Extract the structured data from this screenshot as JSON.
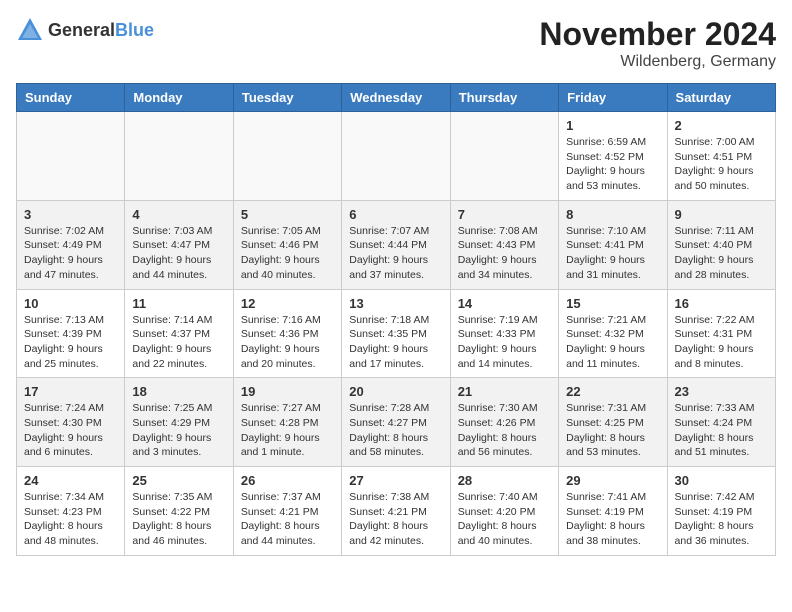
{
  "header": {
    "logo_general": "General",
    "logo_blue": "Blue",
    "title": "November 2024",
    "subtitle": "Wildenberg, Germany"
  },
  "weekdays": [
    "Sunday",
    "Monday",
    "Tuesday",
    "Wednesday",
    "Thursday",
    "Friday",
    "Saturday"
  ],
  "weeks": [
    [
      {
        "day": "",
        "info": ""
      },
      {
        "day": "",
        "info": ""
      },
      {
        "day": "",
        "info": ""
      },
      {
        "day": "",
        "info": ""
      },
      {
        "day": "",
        "info": ""
      },
      {
        "day": "1",
        "info": "Sunrise: 6:59 AM\nSunset: 4:52 PM\nDaylight: 9 hours and 53 minutes."
      },
      {
        "day": "2",
        "info": "Sunrise: 7:00 AM\nSunset: 4:51 PM\nDaylight: 9 hours and 50 minutes."
      }
    ],
    [
      {
        "day": "3",
        "info": "Sunrise: 7:02 AM\nSunset: 4:49 PM\nDaylight: 9 hours and 47 minutes."
      },
      {
        "day": "4",
        "info": "Sunrise: 7:03 AM\nSunset: 4:47 PM\nDaylight: 9 hours and 44 minutes."
      },
      {
        "day": "5",
        "info": "Sunrise: 7:05 AM\nSunset: 4:46 PM\nDaylight: 9 hours and 40 minutes."
      },
      {
        "day": "6",
        "info": "Sunrise: 7:07 AM\nSunset: 4:44 PM\nDaylight: 9 hours and 37 minutes."
      },
      {
        "day": "7",
        "info": "Sunrise: 7:08 AM\nSunset: 4:43 PM\nDaylight: 9 hours and 34 minutes."
      },
      {
        "day": "8",
        "info": "Sunrise: 7:10 AM\nSunset: 4:41 PM\nDaylight: 9 hours and 31 minutes."
      },
      {
        "day": "9",
        "info": "Sunrise: 7:11 AM\nSunset: 4:40 PM\nDaylight: 9 hours and 28 minutes."
      }
    ],
    [
      {
        "day": "10",
        "info": "Sunrise: 7:13 AM\nSunset: 4:39 PM\nDaylight: 9 hours and 25 minutes."
      },
      {
        "day": "11",
        "info": "Sunrise: 7:14 AM\nSunset: 4:37 PM\nDaylight: 9 hours and 22 minutes."
      },
      {
        "day": "12",
        "info": "Sunrise: 7:16 AM\nSunset: 4:36 PM\nDaylight: 9 hours and 20 minutes."
      },
      {
        "day": "13",
        "info": "Sunrise: 7:18 AM\nSunset: 4:35 PM\nDaylight: 9 hours and 17 minutes."
      },
      {
        "day": "14",
        "info": "Sunrise: 7:19 AM\nSunset: 4:33 PM\nDaylight: 9 hours and 14 minutes."
      },
      {
        "day": "15",
        "info": "Sunrise: 7:21 AM\nSunset: 4:32 PM\nDaylight: 9 hours and 11 minutes."
      },
      {
        "day": "16",
        "info": "Sunrise: 7:22 AM\nSunset: 4:31 PM\nDaylight: 9 hours and 8 minutes."
      }
    ],
    [
      {
        "day": "17",
        "info": "Sunrise: 7:24 AM\nSunset: 4:30 PM\nDaylight: 9 hours and 6 minutes."
      },
      {
        "day": "18",
        "info": "Sunrise: 7:25 AM\nSunset: 4:29 PM\nDaylight: 9 hours and 3 minutes."
      },
      {
        "day": "19",
        "info": "Sunrise: 7:27 AM\nSunset: 4:28 PM\nDaylight: 9 hours and 1 minute."
      },
      {
        "day": "20",
        "info": "Sunrise: 7:28 AM\nSunset: 4:27 PM\nDaylight: 8 hours and 58 minutes."
      },
      {
        "day": "21",
        "info": "Sunrise: 7:30 AM\nSunset: 4:26 PM\nDaylight: 8 hours and 56 minutes."
      },
      {
        "day": "22",
        "info": "Sunrise: 7:31 AM\nSunset: 4:25 PM\nDaylight: 8 hours and 53 minutes."
      },
      {
        "day": "23",
        "info": "Sunrise: 7:33 AM\nSunset: 4:24 PM\nDaylight: 8 hours and 51 minutes."
      }
    ],
    [
      {
        "day": "24",
        "info": "Sunrise: 7:34 AM\nSunset: 4:23 PM\nDaylight: 8 hours and 48 minutes."
      },
      {
        "day": "25",
        "info": "Sunrise: 7:35 AM\nSunset: 4:22 PM\nDaylight: 8 hours and 46 minutes."
      },
      {
        "day": "26",
        "info": "Sunrise: 7:37 AM\nSunset: 4:21 PM\nDaylight: 8 hours and 44 minutes."
      },
      {
        "day": "27",
        "info": "Sunrise: 7:38 AM\nSunset: 4:21 PM\nDaylight: 8 hours and 42 minutes."
      },
      {
        "day": "28",
        "info": "Sunrise: 7:40 AM\nSunset: 4:20 PM\nDaylight: 8 hours and 40 minutes."
      },
      {
        "day": "29",
        "info": "Sunrise: 7:41 AM\nSunset: 4:19 PM\nDaylight: 8 hours and 38 minutes."
      },
      {
        "day": "30",
        "info": "Sunrise: 7:42 AM\nSunset: 4:19 PM\nDaylight: 8 hours and 36 minutes."
      }
    ]
  ]
}
